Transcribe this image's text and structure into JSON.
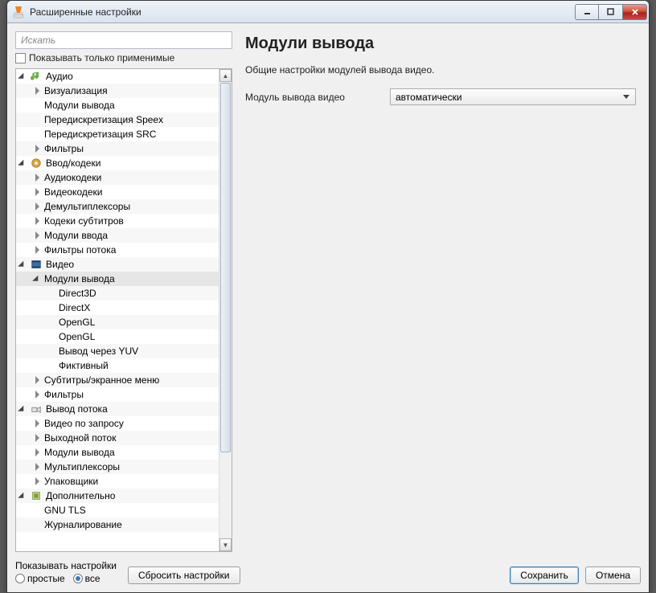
{
  "window": {
    "title": "Расширенные настройки"
  },
  "left": {
    "search_placeholder": "Искать",
    "show_applicable": "Показывать только применимые",
    "items": [
      {
        "d": 0,
        "a": "exp",
        "i": "audio",
        "t": "Аудио"
      },
      {
        "d": 1,
        "a": "col",
        "t": "Визуализация"
      },
      {
        "d": 1,
        "a": "none",
        "t": "Модули вывода"
      },
      {
        "d": 1,
        "a": "none",
        "t": "Передискретизация Speex"
      },
      {
        "d": 1,
        "a": "none",
        "t": "Передискретизация SRC"
      },
      {
        "d": 1,
        "a": "col",
        "t": "Фильтры"
      },
      {
        "d": 0,
        "a": "exp",
        "i": "codec",
        "t": "Ввод/кодеки"
      },
      {
        "d": 1,
        "a": "col",
        "t": "Аудиокодеки"
      },
      {
        "d": 1,
        "a": "col",
        "t": "Видеокодеки"
      },
      {
        "d": 1,
        "a": "col",
        "t": "Демультиплексоры"
      },
      {
        "d": 1,
        "a": "col",
        "t": "Кодеки субтитров"
      },
      {
        "d": 1,
        "a": "col",
        "t": "Модули ввода"
      },
      {
        "d": 1,
        "a": "col",
        "t": "Фильтры потока"
      },
      {
        "d": 0,
        "a": "exp",
        "i": "video",
        "t": "Видео"
      },
      {
        "d": 1,
        "a": "exp",
        "t": "Модули вывода",
        "sel": true
      },
      {
        "d": 2,
        "a": "none",
        "t": "Direct3D"
      },
      {
        "d": 2,
        "a": "none",
        "t": "DirectX"
      },
      {
        "d": 2,
        "a": "none",
        "t": "OpenGL"
      },
      {
        "d": 2,
        "a": "none",
        "t": "OpenGL"
      },
      {
        "d": 2,
        "a": "none",
        "t": "Вывод через YUV"
      },
      {
        "d": 2,
        "a": "none",
        "t": "Фиктивный"
      },
      {
        "d": 1,
        "a": "col",
        "t": "Субтитры/экранное меню"
      },
      {
        "d": 1,
        "a": "col",
        "t": "Фильтры"
      },
      {
        "d": 0,
        "a": "exp",
        "i": "stream",
        "t": "Вывод потока"
      },
      {
        "d": 1,
        "a": "col",
        "t": "Видео по запросу"
      },
      {
        "d": 1,
        "a": "col",
        "t": "Выходной поток"
      },
      {
        "d": 1,
        "a": "col",
        "t": "Модули вывода"
      },
      {
        "d": 1,
        "a": "col",
        "t": "Мультиплексоры"
      },
      {
        "d": 1,
        "a": "col",
        "t": "Упаковщики"
      },
      {
        "d": 0,
        "a": "exp",
        "i": "adv",
        "t": "Дополнительно"
      },
      {
        "d": 1,
        "a": "none",
        "t": "GNU TLS"
      },
      {
        "d": 1,
        "a": "none",
        "t": "Журналирование"
      }
    ]
  },
  "right": {
    "heading": "Модули вывода",
    "description": "Общие настройки модулей вывода видео.",
    "field_label": "Модуль вывода видео",
    "dropdown_value": "автоматически"
  },
  "bottom": {
    "show_settings": "Показывать настройки",
    "simple": "простые",
    "all": "все",
    "reset": "Сбросить настройки",
    "save": "Сохранить",
    "cancel": "Отмена"
  }
}
